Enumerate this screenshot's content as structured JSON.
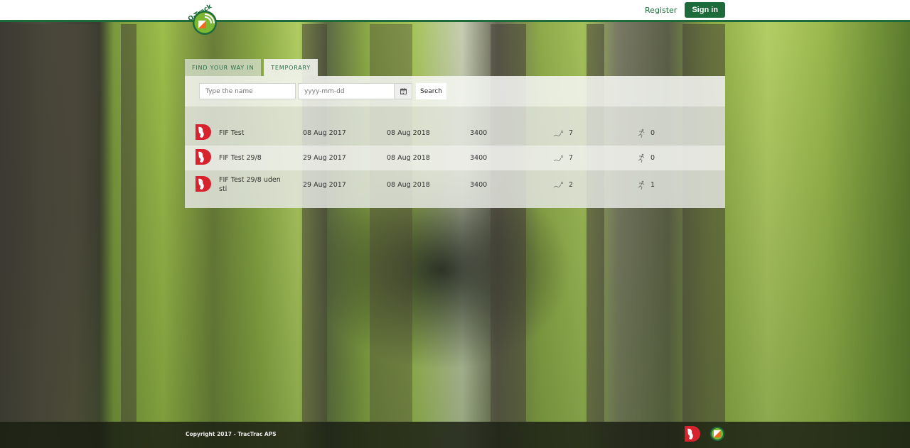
{
  "header": {
    "logo_text": "O-Track",
    "register_label": "Register",
    "signin_label": "Sign in"
  },
  "colors": {
    "brand_green": "#1d6b3b",
    "logo_green": "#7cb833",
    "logo_orange": "#f26a21",
    "club_red": "#d7232e"
  },
  "tabs": [
    {
      "label": "Find your way in",
      "active": false
    },
    {
      "label": "Temporary",
      "active": true
    }
  ],
  "search": {
    "name_placeholder": "Type the name",
    "name_value": "",
    "date_placeholder": "yyyy-mm-dd",
    "date_value": "",
    "calendar_icon": "calendar-icon",
    "search_label": "Search"
  },
  "events": [
    {
      "club_icon": "club-logo-icon",
      "name": "FIF Test",
      "start": "08 Aug 2017",
      "end": "08 Aug 2018",
      "code": "3400",
      "tracks_icon": "track-icon",
      "tracks": "7",
      "runners_icon": "runner-icon",
      "runners": "0"
    },
    {
      "club_icon": "club-logo-icon",
      "name": "FIF Test 29/8",
      "start": "29 Aug 2017",
      "end": "08 Aug 2018",
      "code": "3400",
      "tracks_icon": "track-icon",
      "tracks": "7",
      "runners_icon": "runner-icon",
      "runners": "0"
    },
    {
      "club_icon": "club-logo-icon",
      "name": "FIF Test 29/8 uden sti",
      "start": "29 Aug 2017",
      "end": "08 Aug 2018",
      "code": "3400",
      "tracks_icon": "track-icon",
      "tracks": "2",
      "runners_icon": "runner-icon",
      "runners": "1"
    }
  ],
  "footer": {
    "copyright": "Copyright 2017 - TracTrac APS"
  }
}
